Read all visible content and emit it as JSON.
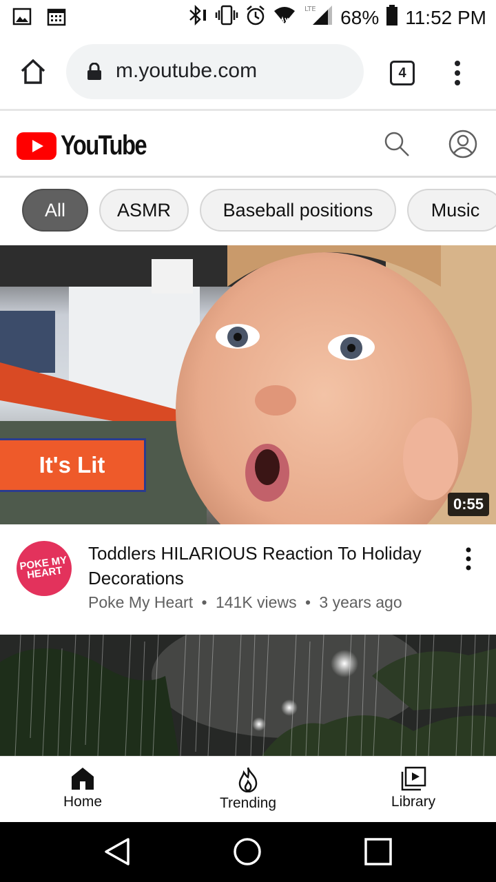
{
  "status_bar": {
    "battery_percent": "68%",
    "time": "11:52 PM"
  },
  "browser": {
    "url": "m.youtube.com",
    "tab_count": "4"
  },
  "youtube": {
    "logo_text": "YouTube",
    "chips": [
      "All",
      "ASMR",
      "Baseball positions",
      "Music"
    ],
    "active_chip": "All"
  },
  "videos": [
    {
      "thumbnail_label": "It's Lit",
      "duration": "0:55",
      "channel_avatar_text": "POKE MY HEART",
      "title": "Toddlers HILARIOUS Reaction To Holiday Decorations",
      "channel": "Poke My Heart",
      "views": "141K views",
      "age": "3 years ago",
      "sep": "•"
    }
  ],
  "bottom_nav": {
    "items": [
      "Home",
      "Trending",
      "Library"
    ]
  },
  "colors": {
    "youtube_red": "#ff0000",
    "chip_active_bg": "#606060",
    "avatar_bg": "#e3325c",
    "label_orange": "#ee5a2a"
  }
}
